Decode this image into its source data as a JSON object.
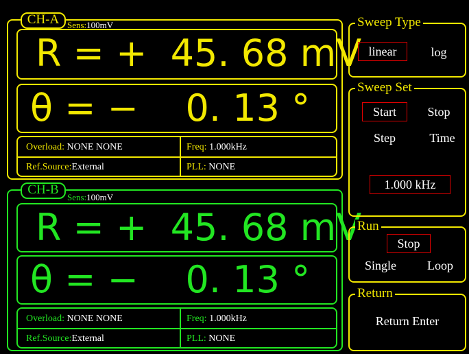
{
  "channel_a": {
    "tag": "CH-A",
    "sens_label": "Sens:",
    "sens_value": "100mV",
    "r_line": "R = +  45. 68 mV",
    "theta_line": "θ = −    0. 13 °",
    "overload_label": "Overload:",
    "overload_value": "NONE  NONE",
    "freq_label": "Freq:",
    "freq_value": "1.000kHz",
    "refsource_label": "Ref.Source:",
    "refsource_value": "External",
    "pll_label": "PLL:",
    "pll_value": "NONE"
  },
  "channel_b": {
    "tag": "CH-B",
    "sens_label": "Sens:",
    "sens_value": "100mV",
    "r_line": "R = +  45. 68 mV",
    "theta_line": "θ = −    0. 13 °",
    "overload_label": "Overload:",
    "overload_value": "NONE  NONE",
    "freq_label": "Freq:",
    "freq_value": "1.000kHz",
    "refsource_label": "Ref.Source:",
    "refsource_value": "External",
    "pll_label": "PLL:",
    "pll_value": "NONE"
  },
  "sweep_type": {
    "title": "Sweep Type",
    "linear": "linear",
    "log": "log",
    "selected": "linear"
  },
  "sweep_set": {
    "title": "Sweep Set",
    "start": "Start",
    "stop": "Stop",
    "step": "Step",
    "time": "Time",
    "selected": "Start",
    "value": "1.000 kHz"
  },
  "run": {
    "title": "Run",
    "stop": "Stop",
    "single": "Single",
    "loop": "Loop",
    "selected": "Stop"
  },
  "return_panel": {
    "title": "Return",
    "label": "Return Enter"
  },
  "colors": {
    "channel_a": "#f2e800",
    "channel_b": "#22e622",
    "selection": "#e00000",
    "text": "#ffffff",
    "background": "#000000"
  }
}
